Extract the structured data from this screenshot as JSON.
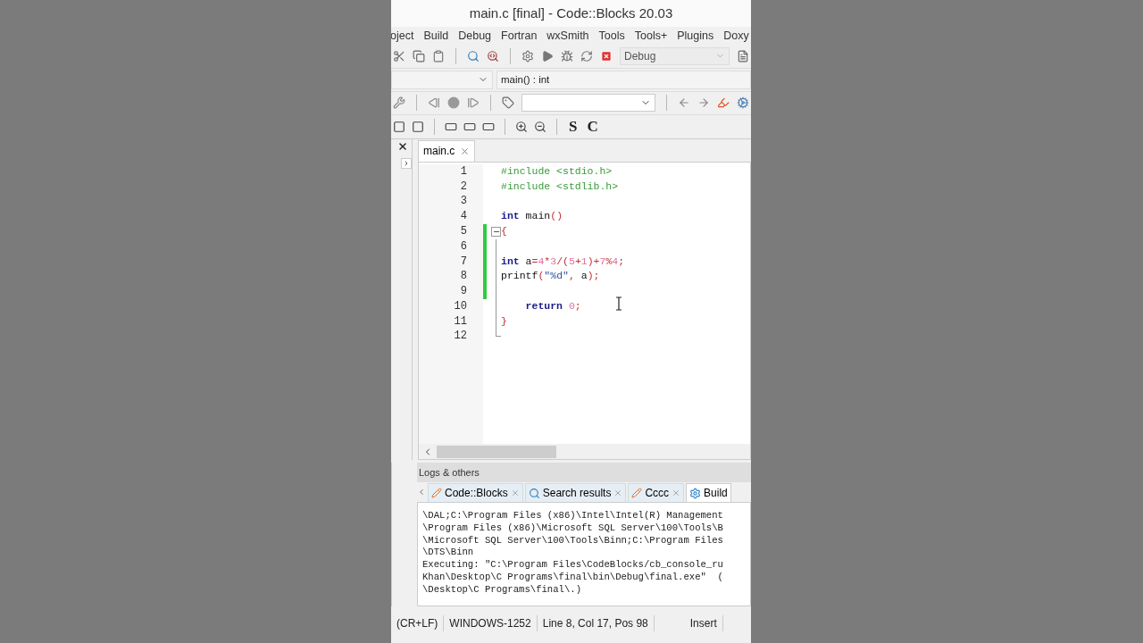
{
  "window": {
    "title": "main.c [final] - Code::Blocks 20.03"
  },
  "menu": [
    "oject",
    "Build",
    "Debug",
    "Fortran",
    "wxSmith",
    "Tools",
    "Tools+",
    "Plugins",
    "Doxy"
  ],
  "build_target": {
    "value": "Debug"
  },
  "format_buttons": [
    "S",
    "C"
  ],
  "scope_bar": {
    "function": "main() : int"
  },
  "editor_tabs": [
    {
      "label": "main.c",
      "selected": true
    }
  ],
  "code": [
    {
      "number": "1",
      "changed": false,
      "kind": "plain",
      "tokens": [
        {
          "kind": "pre",
          "text": "#include <stdio.h>"
        }
      ]
    },
    {
      "number": "2",
      "changed": false,
      "kind": "plain",
      "tokens": [
        {
          "kind": "pre",
          "text": "#include <stdlib.h>"
        }
      ]
    },
    {
      "number": "3",
      "changed": false,
      "kind": "plain"
    },
    {
      "number": "4",
      "changed": false,
      "kind": "plain",
      "tokens": [
        {
          "kind": "kw",
          "text": "int"
        },
        {
          "kind": "id",
          "text": " main"
        },
        {
          "kind": "op",
          "text": "()"
        }
      ]
    },
    {
      "number": "5",
      "changed": true,
      "kind": "foldstart",
      "tokens": [
        {
          "kind": "op",
          "text": "{"
        }
      ]
    },
    {
      "number": "6",
      "changed": true,
      "kind": "folded"
    },
    {
      "number": "7",
      "changed": true,
      "kind": "folded",
      "tokens": [
        {
          "kind": "kw",
          "text": "int"
        },
        {
          "kind": "id",
          "text": " a"
        },
        {
          "kind": "op",
          "text": "="
        },
        {
          "kind": "num",
          "text": "4"
        },
        {
          "kind": "op",
          "text": "*"
        },
        {
          "kind": "num",
          "text": "3"
        },
        {
          "kind": "op",
          "text": "/("
        },
        {
          "kind": "num",
          "text": "5"
        },
        {
          "kind": "op",
          "text": "+"
        },
        {
          "kind": "num",
          "text": "1"
        },
        {
          "kind": "op",
          "text": ")+"
        },
        {
          "kind": "num",
          "text": "7"
        },
        {
          "kind": "op",
          "text": "%"
        },
        {
          "kind": "num",
          "text": "4"
        },
        {
          "kind": "op",
          "text": ";"
        }
      ]
    },
    {
      "number": "8",
      "changed": true,
      "kind": "folded",
      "tokens": [
        {
          "kind": "id",
          "text": "printf"
        },
        {
          "kind": "op",
          "text": "("
        },
        {
          "kind": "str",
          "text": "\"%d\""
        },
        {
          "kind": "op",
          "text": ","
        },
        {
          "kind": "id",
          "text": " a"
        },
        {
          "kind": "op",
          "text": ");"
        }
      ]
    },
    {
      "number": "9",
      "changed": true,
      "kind": "folded"
    },
    {
      "number": "10",
      "changed": false,
      "kind": "folded",
      "tokens": [
        {
          "kind": "kw",
          "text": "    return"
        },
        {
          "kind": "num",
          "text": " 0"
        },
        {
          "kind": "op",
          "text": ";"
        }
      ]
    },
    {
      "number": "11",
      "changed": false,
      "kind": "folded",
      "tokens": [
        {
          "kind": "op",
          "text": "}"
        }
      ]
    },
    {
      "number": "12",
      "changed": false,
      "kind": "foldend"
    }
  ],
  "logs": {
    "title": "Logs & others",
    "tabs": [
      {
        "label": "Code::Blocks",
        "kind": "log",
        "selected": false
      },
      {
        "label": "Search results",
        "kind": "search",
        "selected": false
      },
      {
        "label": "Cccc",
        "kind": "log",
        "selected": false
      },
      {
        "label": "Build",
        "kind": "build",
        "selected": true
      }
    ],
    "lines": [
      "\\DAL;C:\\Program Files (x86)\\Intel\\Intel(R) Management",
      "\\Program Files (x86)\\Microsoft SQL Server\\100\\Tools\\B",
      "\\Microsoft SQL Server\\100\\Tools\\Binn;C:\\Program Files",
      "\\DTS\\Binn",
      "Executing: \"C:\\Program Files\\CodeBlocks/cb_console_ru",
      "Khan\\Desktop\\C Programs\\final\\bin\\Debug\\final.exe\"  (",
      "\\Desktop\\C Programs\\final\\.)"
    ]
  },
  "status_bar": [
    "(CR+LF)",
    "WINDOWS-1252",
    "Line 8, Col 17, Pos 98",
    "Insert"
  ]
}
